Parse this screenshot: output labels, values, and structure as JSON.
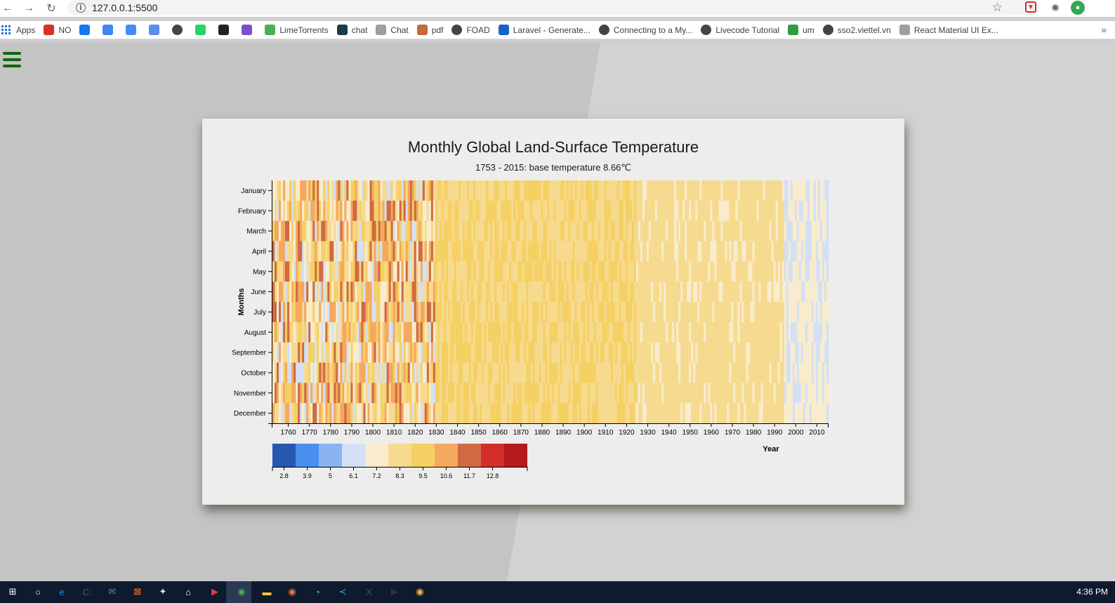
{
  "browser": {
    "url": "127.0.0.1:5500",
    "bookmarks": [
      {
        "label": "Apps",
        "icon": "apps-grid-icon",
        "color": "#1a73e8"
      },
      {
        "label": "NO",
        "icon": "chrome-icon",
        "color": "#d93025"
      },
      {
        "label": "",
        "icon": "facebook-icon",
        "color": "#1877f2"
      },
      {
        "label": "",
        "icon": "google-icon",
        "color": "#4285f4"
      },
      {
        "label": "",
        "icon": "translate-icon",
        "color": "#4a8af4"
      },
      {
        "label": "",
        "icon": "download-icon",
        "color": "#5b8def"
      },
      {
        "label": "",
        "icon": "globe-icon",
        "color": "#444444"
      },
      {
        "label": "",
        "icon": "whatsapp-icon",
        "color": "#25d366"
      },
      {
        "label": "",
        "icon": "flag-icon",
        "color": "#222222"
      },
      {
        "label": "",
        "icon": "cube-icon",
        "color": "#7b4fc9"
      },
      {
        "label": "LimeTorrents",
        "icon": "lime-icon",
        "color": "#4caf50"
      },
      {
        "label": "chat",
        "icon": "chat-icon",
        "color": "#1b3a4b"
      },
      {
        "label": "Chat",
        "icon": "page-icon",
        "color": "#9e9e9e"
      },
      {
        "label": "pdf",
        "icon": "pdf-icon",
        "color": "#c26a3a"
      },
      {
        "label": "FOAD",
        "icon": "globe-icon",
        "color": "#444444"
      },
      {
        "label": "Laravel - Generate...",
        "icon": "laravel-icon",
        "color": "#1565c0"
      },
      {
        "label": "Connecting to a My...",
        "icon": "globe-icon",
        "color": "#444444"
      },
      {
        "label": "Livecode Tutorial",
        "icon": "globe-icon",
        "color": "#444444"
      },
      {
        "label": "um",
        "icon": "leaf-icon",
        "color": "#2e9d3a"
      },
      {
        "label": "sso2.viettel.vn",
        "icon": "globe-icon",
        "color": "#444444"
      },
      {
        "label": "React Material UI Ex...",
        "icon": "page-icon",
        "color": "#9e9e9e"
      }
    ],
    "more": "»"
  },
  "chart": {
    "title": "Monthly Global Land-Surface Temperature",
    "subtitle": "1753 - 2015: base temperature 8.66℃",
    "ylabel": "Months",
    "xlabel": "Year"
  },
  "chart_data": {
    "type": "heatmap",
    "title": "Monthly Global Land-Surface Temperature",
    "subtitle": "1753 - 2015: base temperature 8.66℃",
    "xlabel": "Year",
    "ylabel": "Months",
    "x_range": [
      1753,
      2015
    ],
    "x_ticks": [
      1760,
      1770,
      1780,
      1790,
      1800,
      1810,
      1820,
      1830,
      1840,
      1850,
      1860,
      1870,
      1880,
      1890,
      1900,
      1910,
      1920,
      1930,
      1940,
      1950,
      1960,
      1970,
      1980,
      1990,
      2000,
      2010
    ],
    "y_categories": [
      "January",
      "February",
      "March",
      "April",
      "May",
      "June",
      "July",
      "August",
      "September",
      "October",
      "November",
      "December"
    ],
    "base_temperature": 8.66,
    "color_scale": {
      "colors": [
        "#2857b0",
        "#4a8ef0",
        "#8bb3f2",
        "#d3e0f5",
        "#f9eccd",
        "#f6da8f",
        "#f5d063",
        "#f5a85f",
        "#cf6a43",
        "#d42c2a",
        "#b31b1e"
      ],
      "thresholds": [
        2.8,
        3.9,
        5,
        6.1,
        7.2,
        8.3,
        9.5,
        10.6,
        11.7,
        12.8
      ]
    }
  },
  "taskbar": {
    "time": "4:36 PM",
    "apps": [
      "windows-start-icon",
      "cortana-icon",
      "edge-icon",
      "terminal-icon",
      "mail-icon",
      "xampp-icon",
      "bird-icon",
      "store-icon",
      "media-icon",
      "chrome-icon",
      "folder-icon",
      "firefox-icon",
      "android-studio-icon",
      "vscode-icon",
      "excel-icon",
      "video-icon",
      "chrome-canary-icon"
    ]
  }
}
